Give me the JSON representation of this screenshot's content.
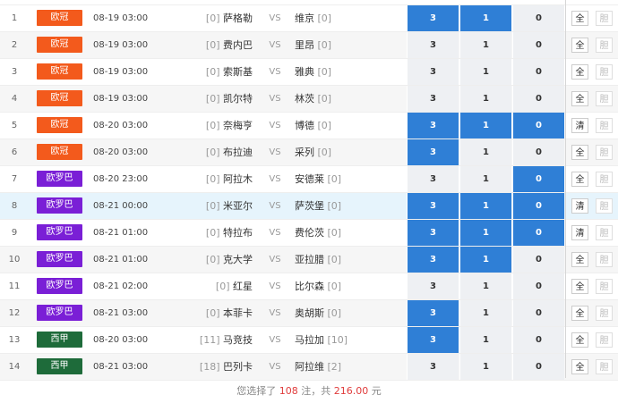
{
  "matches": [
    {
      "no": "1",
      "league": "欧冠",
      "league_color": "#f35a1c",
      "time": "08-19 03:00",
      "home_rank": "[0]",
      "home": "萨格勒",
      "vs": "VS",
      "away": "维京",
      "away_rank": "[0]",
      "odds": [
        "3",
        "1",
        "0"
      ],
      "sel": [
        true,
        true,
        false
      ],
      "btn1": "全",
      "btn2": "胆"
    },
    {
      "no": "2",
      "league": "欧冠",
      "league_color": "#f35a1c",
      "time": "08-19 03:00",
      "home_rank": "[0]",
      "home": "费内巴",
      "vs": "VS",
      "away": "里昂",
      "away_rank": "[0]",
      "odds": [
        "3",
        "1",
        "0"
      ],
      "sel": [
        false,
        false,
        false
      ],
      "btn1": "全",
      "btn2": "胆"
    },
    {
      "no": "3",
      "league": "欧冠",
      "league_color": "#f35a1c",
      "time": "08-19 03:00",
      "home_rank": "[0]",
      "home": "索斯基",
      "vs": "VS",
      "away": "雅典",
      "away_rank": "[0]",
      "odds": [
        "3",
        "1",
        "0"
      ],
      "sel": [
        false,
        false,
        false
      ],
      "btn1": "全",
      "btn2": "胆"
    },
    {
      "no": "4",
      "league": "欧冠",
      "league_color": "#f35a1c",
      "time": "08-19 03:00",
      "home_rank": "[0]",
      "home": "凯尔特",
      "vs": "VS",
      "away": "林茨",
      "away_rank": "[0]",
      "odds": [
        "3",
        "1",
        "0"
      ],
      "sel": [
        false,
        false,
        false
      ],
      "btn1": "全",
      "btn2": "胆"
    },
    {
      "no": "5",
      "league": "欧冠",
      "league_color": "#f35a1c",
      "time": "08-20 03:00",
      "home_rank": "[0]",
      "home": "奈梅亨",
      "vs": "VS",
      "away": "博德",
      "away_rank": "[0]",
      "odds": [
        "3",
        "1",
        "0"
      ],
      "sel": [
        true,
        true,
        true
      ],
      "btn1": "清",
      "btn2": "胆"
    },
    {
      "no": "6",
      "league": "欧冠",
      "league_color": "#f35a1c",
      "time": "08-20 03:00",
      "home_rank": "[0]",
      "home": "布拉迪",
      "vs": "VS",
      "away": "采列",
      "away_rank": "[0]",
      "odds": [
        "3",
        "1",
        "0"
      ],
      "sel": [
        true,
        false,
        false
      ],
      "btn1": "全",
      "btn2": "胆"
    },
    {
      "no": "7",
      "league": "欧罗巴",
      "league_color": "#7a1fd6",
      "time": "08-20 23:00",
      "home_rank": "[0]",
      "home": "阿拉木",
      "vs": "VS",
      "away": "安德莱",
      "away_rank": "[0]",
      "odds": [
        "3",
        "1",
        "0"
      ],
      "sel": [
        false,
        false,
        true
      ],
      "btn1": "全",
      "btn2": "胆"
    },
    {
      "no": "8",
      "league": "欧罗巴",
      "league_color": "#7a1fd6",
      "time": "08-21 00:00",
      "home_rank": "[0]",
      "home": "米亚尔",
      "vs": "VS",
      "away": "萨茨堡",
      "away_rank": "[0]",
      "odds": [
        "3",
        "1",
        "0"
      ],
      "sel": [
        true,
        true,
        true
      ],
      "btn1": "清",
      "btn2": "胆"
    },
    {
      "no": "9",
      "league": "欧罗巴",
      "league_color": "#7a1fd6",
      "time": "08-21 01:00",
      "home_rank": "[0]",
      "home": "特拉布",
      "vs": "VS",
      "away": "费伦茨",
      "away_rank": "[0]",
      "odds": [
        "3",
        "1",
        "0"
      ],
      "sel": [
        true,
        true,
        true
      ],
      "btn1": "清",
      "btn2": "胆"
    },
    {
      "no": "10",
      "league": "欧罗巴",
      "league_color": "#7a1fd6",
      "time": "08-21 01:00",
      "home_rank": "[0]",
      "home": "克大学",
      "vs": "VS",
      "away": "亚拉腊",
      "away_rank": "[0]",
      "odds": [
        "3",
        "1",
        "0"
      ],
      "sel": [
        true,
        true,
        false
      ],
      "btn1": "全",
      "btn2": "胆"
    },
    {
      "no": "11",
      "league": "欧罗巴",
      "league_color": "#7a1fd6",
      "time": "08-21 02:00",
      "home_rank": "[0]",
      "home": "红星",
      "vs": "VS",
      "away": "比尔森",
      "away_rank": "[0]",
      "odds": [
        "3",
        "1",
        "0"
      ],
      "sel": [
        false,
        false,
        false
      ],
      "btn1": "全",
      "btn2": "胆"
    },
    {
      "no": "12",
      "league": "欧罗巴",
      "league_color": "#7a1fd6",
      "time": "08-21 03:00",
      "home_rank": "[0]",
      "home": "本菲卡",
      "vs": "VS",
      "away": "奥胡斯",
      "away_rank": "[0]",
      "odds": [
        "3",
        "1",
        "0"
      ],
      "sel": [
        true,
        false,
        false
      ],
      "btn1": "全",
      "btn2": "胆"
    },
    {
      "no": "13",
      "league": "西甲",
      "league_color": "#1e6b3a",
      "time": "08-20 03:00",
      "home_rank": "[11]",
      "home": "马竞技",
      "vs": "VS",
      "away": "马拉加",
      "away_rank": "[10]",
      "odds": [
        "3",
        "1",
        "0"
      ],
      "sel": [
        true,
        false,
        false
      ],
      "btn1": "全",
      "btn2": "胆"
    },
    {
      "no": "14",
      "league": "西甲",
      "league_color": "#1e6b3a",
      "time": "08-21 03:00",
      "home_rank": "[18]",
      "home": "巴列卡",
      "vs": "VS",
      "away": "阿拉维",
      "away_rank": "[2]",
      "odds": [
        "3",
        "1",
        "0"
      ],
      "sel": [
        false,
        false,
        false
      ],
      "btn1": "全",
      "btn2": "胆"
    }
  ],
  "footer": {
    "prefix": "您选择了",
    "count": "108",
    "mid": "注，共",
    "amount": "216.00",
    "suffix": "元"
  }
}
